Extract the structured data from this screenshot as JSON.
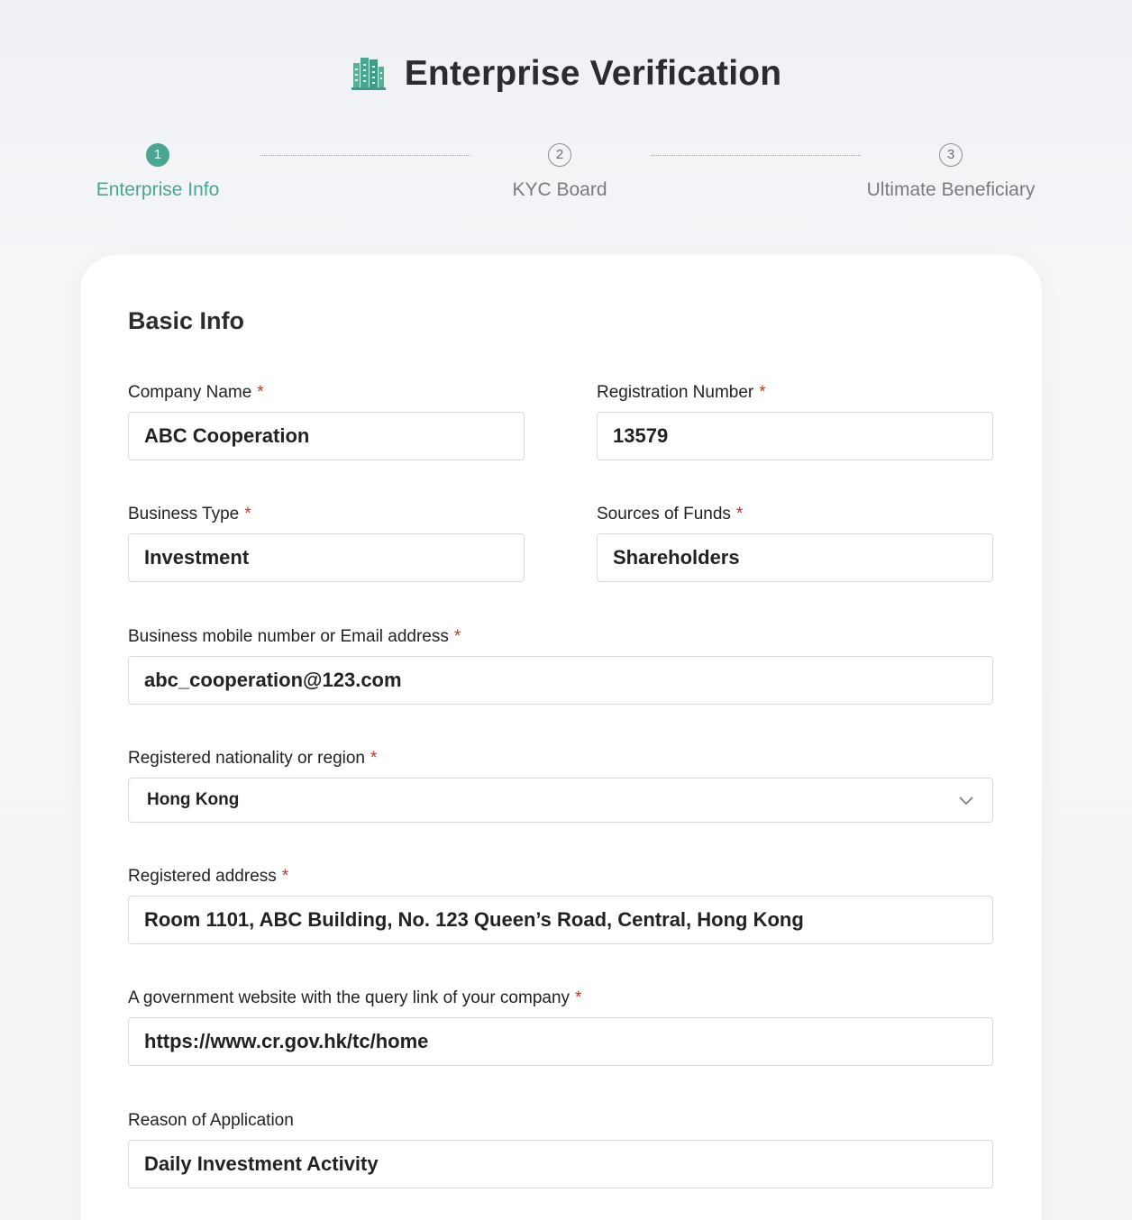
{
  "header": {
    "title": "Enterprise Verification",
    "icon": "building-icon",
    "accent_color": "#4aa591"
  },
  "stepper": {
    "active_step": 1,
    "steps": [
      {
        "number": "1",
        "label": "Enterprise Info"
      },
      {
        "number": "2",
        "label": "KYC Board"
      },
      {
        "number": "3",
        "label": "Ultimate Beneficiary"
      }
    ]
  },
  "form": {
    "section_title": "Basic Info",
    "required_marker": "*",
    "company_name": {
      "label": "Company Name",
      "value": "ABC Cooperation"
    },
    "registration_number": {
      "label": "Registration Number",
      "value": "13579"
    },
    "business_type": {
      "label": "Business Type",
      "value": "Investment"
    },
    "sources_of_funds": {
      "label": "Sources of Funds",
      "value": "Shareholders"
    },
    "contact": {
      "label": "Business mobile number or Email address",
      "value": "abc_cooperation@123.com"
    },
    "nationality": {
      "label": "Registered nationality or region",
      "value": "Hong Kong"
    },
    "address": {
      "label": "Registered address",
      "value": "Room 1101, ABC Building, No. 123 Queen’s Road, Central, Hong Kong"
    },
    "gov_website": {
      "label": "A government website with the query link of your company",
      "value": "https://www.cr.gov.hk/tc/home"
    },
    "reason": {
      "label": "Reason of Application",
      "value": "Daily Investment Activity"
    }
  }
}
